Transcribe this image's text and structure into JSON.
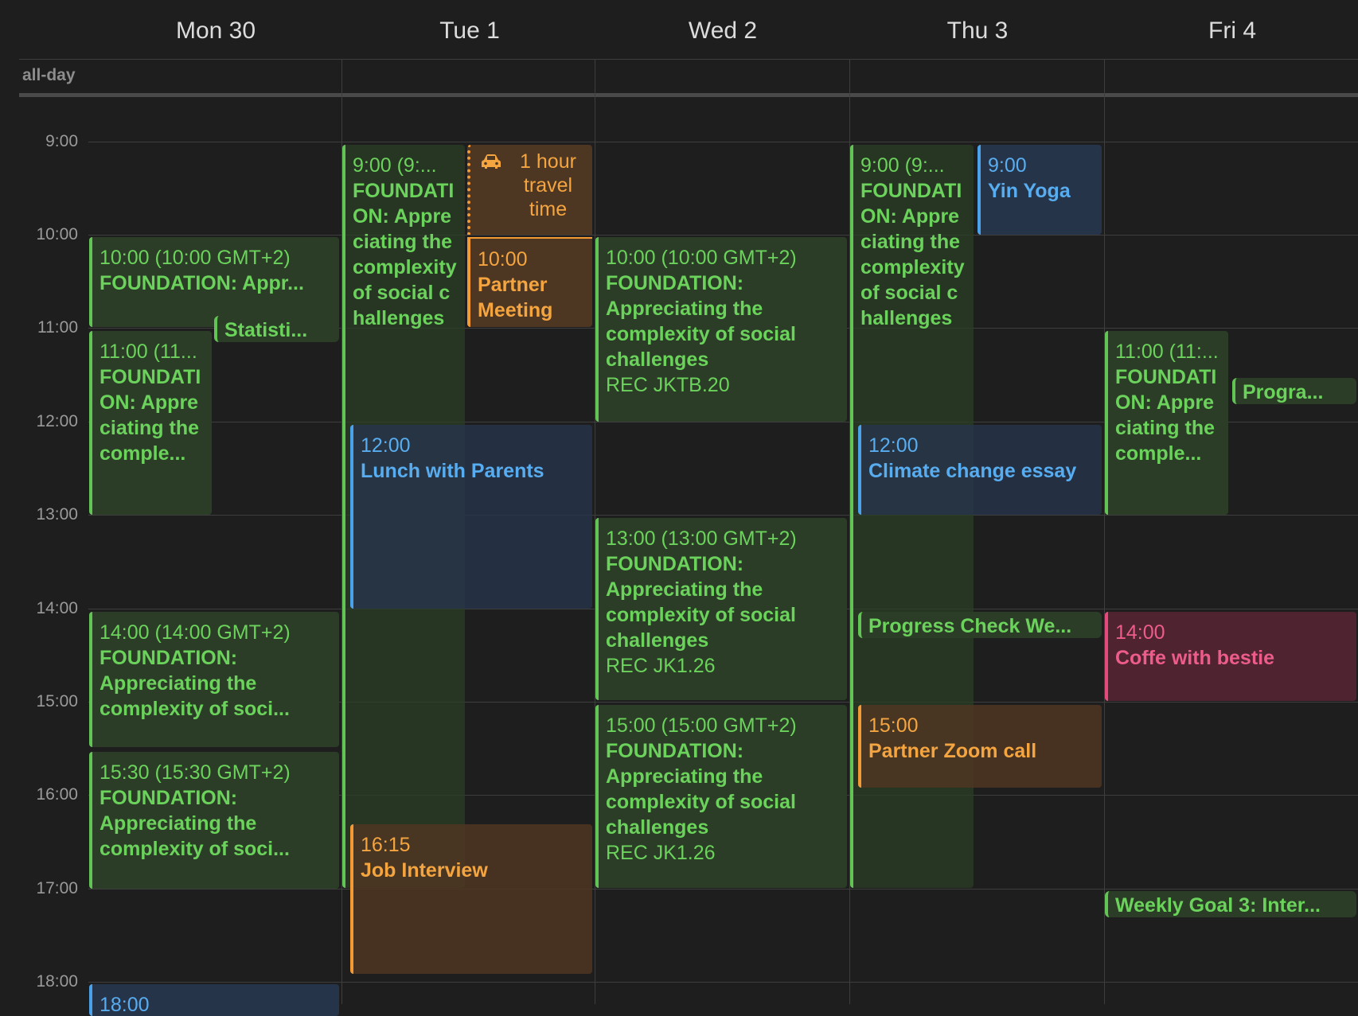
{
  "days": [
    "Mon 30",
    "Tue 1",
    "Wed 2",
    "Thu 3",
    "Fri 4"
  ],
  "all_day_label": "all-day",
  "hours": [
    "9:00",
    "10:00",
    "11:00",
    "12:00",
    "13:00",
    "14:00",
    "15:00",
    "16:00",
    "17:00",
    "18:00"
  ],
  "colors": {
    "green": "#62c454",
    "blue": "#4aa3ea",
    "orange": "#f39a34",
    "pink": "#e44a7b",
    "background": "#1e1e1e"
  },
  "travel": {
    "icon": "car-icon",
    "text": "1 hour travel time"
  },
  "events": {
    "mon_1": {
      "time": "10:00 (10:00 GMT+2)",
      "name": "FOUNDATION: Appr..."
    },
    "mon_2": {
      "name": "Statisti..."
    },
    "mon_3": {
      "time": "11:00 (11...",
      "name": "FOUNDATION: Appreciating the comple..."
    },
    "mon_4": {
      "time": "14:00 (14:00 GMT+2)",
      "name": "FOUNDATION: Appreciating the complexity of soci..."
    },
    "mon_5": {
      "time": "15:30 (15:30 GMT+2)",
      "name": "FOUNDATION: Appreciating the complexity of soci..."
    },
    "mon_6": {
      "time": "18:00"
    },
    "tue_1": {
      "time": "9:00 (9:...",
      "name": "FOUNDATION: Appreciating the complexity of social challenges"
    },
    "tue_2": {
      "time": "10:00",
      "name": "Partner Meeting"
    },
    "tue_3": {
      "time": "12:00",
      "name": "Lunch with Parents"
    },
    "tue_4": {
      "time": "16:15",
      "name": "Job Interview"
    },
    "wed_1": {
      "time": "10:00 (10:00 GMT+2)",
      "name": "FOUNDATION: Appreciating the complexity of social challenges",
      "location": "REC JKTB.20"
    },
    "wed_2": {
      "time": "13:00 (13:00 GMT+2)",
      "name": "FOUNDATION: Appreciating the complexity of social challenges",
      "location": "REC JK1.26"
    },
    "wed_3": {
      "time": "15:00 (15:00 GMT+2)",
      "name": "FOUNDATION: Appreciating the complexity of social challenges",
      "location": "REC JK1.26"
    },
    "thu_1": {
      "time": "9:00 (9:...",
      "name": "FOUNDATION: Appreciating the complexity of social challenges"
    },
    "thu_2": {
      "time": "9:00",
      "name": "Yin Yoga"
    },
    "thu_3": {
      "time": "12:00",
      "name": "Climate change essay"
    },
    "thu_4": {
      "name": "Progress Check We..."
    },
    "thu_5": {
      "time": "15:00",
      "name": "Partner Zoom call"
    },
    "fri_1": {
      "time": "11:00 (11:...",
      "name": "FOUNDATION: Appreciating the comple..."
    },
    "fri_2": {
      "name": "Progra..."
    },
    "fri_3": {
      "time": "14:00",
      "name": "Coffe with bestie"
    },
    "fri_4": {
      "name": "Weekly Goal 3: Inter..."
    }
  }
}
